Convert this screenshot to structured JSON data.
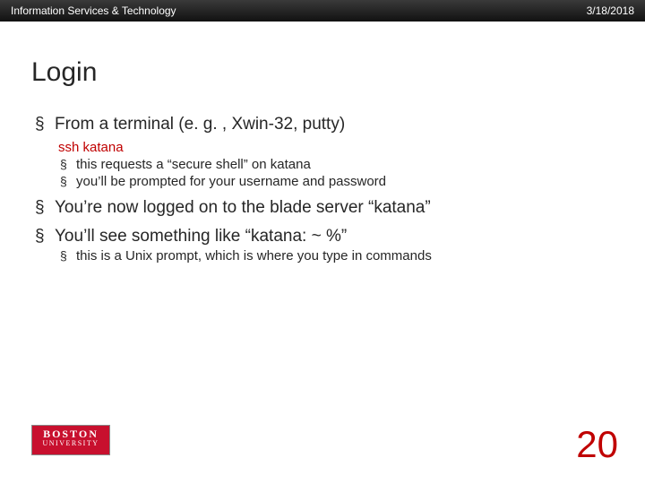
{
  "header": {
    "org": "Information Services & Technology",
    "date": "3/18/2018"
  },
  "title": "Login",
  "bullets": {
    "b1": "From a terminal (e. g. , Xwin-32, putty)",
    "cmd": "ssh katana",
    "b1_sub1": "this requests a “secure shell” on katana",
    "b1_sub2": "you’ll be prompted for your username and password",
    "b2": "You’re now logged on to the blade server “katana”",
    "b3": "You’ll see something like “katana: ~ %”",
    "b3_sub1": "this is a Unix prompt, which is where you type in commands"
  },
  "logo": {
    "line1": "BOSTON",
    "line2": "UNIVERSITY"
  },
  "page_number": "20"
}
